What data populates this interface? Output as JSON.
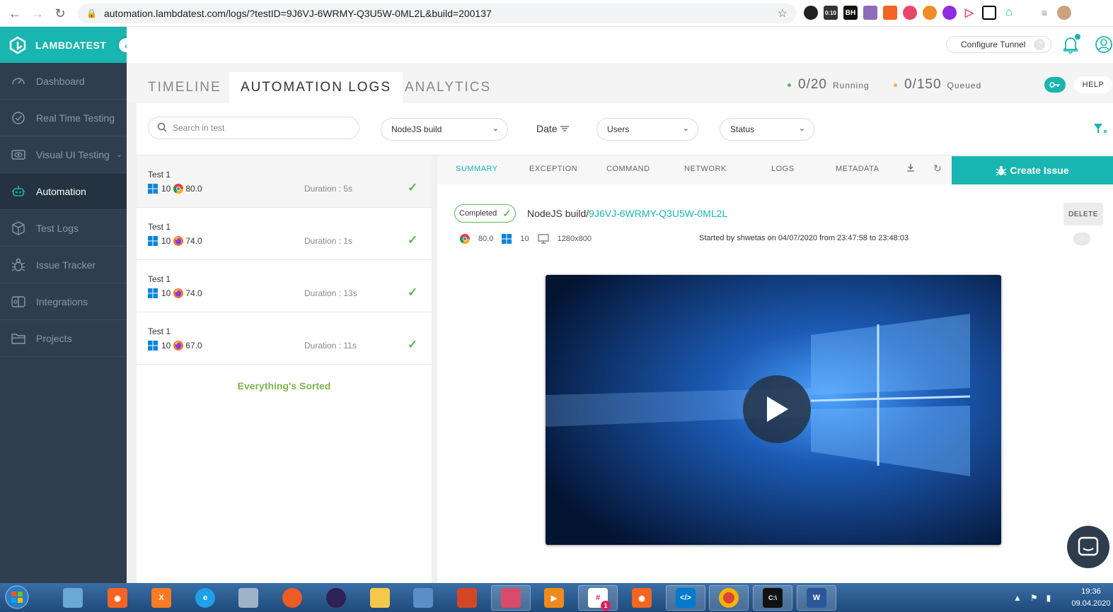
{
  "browser": {
    "url": "automation.lambdatest.com/logs/?testID=9J6VJ-6WRMY-Q3U5W-0ML2L&build=200137",
    "timer_badge": "0:10",
    "ext_bh": "BH"
  },
  "brand": {
    "name": "LAMBDATEST",
    "color": "#19b5b0"
  },
  "sidebar": {
    "items": [
      {
        "label": "Dashboard",
        "icon": "speedometer-icon"
      },
      {
        "label": "Real Time Testing",
        "icon": "clock-icon"
      },
      {
        "label": "Visual UI Testing",
        "icon": "eye-icon"
      },
      {
        "label": "Automation",
        "icon": "robot-icon",
        "active": true
      },
      {
        "label": "Test Logs",
        "icon": "cube-icon"
      },
      {
        "label": "Issue Tracker",
        "icon": "bug-icon"
      },
      {
        "label": "Integrations",
        "icon": "integrations-icon"
      },
      {
        "label": "Projects",
        "icon": "folder-icon"
      }
    ]
  },
  "topbar": {
    "tunnel_label": "Configure Tunnel",
    "tunnel_help": "?"
  },
  "tabs": {
    "timeline": "TIMELINE",
    "automation_logs": "AUTOMATION LOGS",
    "analytics": "ANALYTICS"
  },
  "stats": {
    "running_value": "0/20",
    "running_label": "Running",
    "running_color": "#5cb85c",
    "queued_value": "0/150",
    "queued_label": "Queued",
    "queued_color": "#f0ad4e"
  },
  "help_label": "HELP",
  "filters": {
    "search_placeholder": "Search in test",
    "build_select": "NodeJS build",
    "date_label": "Date",
    "users_select": "Users",
    "status_select": "Status"
  },
  "tests": [
    {
      "name": "Test 1",
      "os_version": "10",
      "browser": "chrome",
      "browser_version": "80.0",
      "duration": "Duration : 5s"
    },
    {
      "name": "Test 1",
      "os_version": "10",
      "browser": "firefox",
      "browser_version": "74.0",
      "duration": "Duration : 1s"
    },
    {
      "name": "Test 1",
      "os_version": "10",
      "browser": "firefox",
      "browser_version": "74.0",
      "duration": "Duration : 13s"
    },
    {
      "name": "Test 1",
      "os_version": "10",
      "browser": "firefox",
      "browser_version": "67.0",
      "duration": "Duration : 11s"
    }
  ],
  "sorted_message": "Everything's Sorted",
  "detail": {
    "tabs": [
      "SUMMARY",
      "EXCEPTION",
      "COMMAND",
      "NETWORK",
      "LOGS",
      "METADATA"
    ],
    "create_issue": "Create Issue",
    "status": "Completed",
    "build_prefix": "NodeJS build/",
    "test_id": "9J6VJ-6WRMY-Q3U5W-0ML2L",
    "delete_label": "DELETE",
    "browser_version": "80.0",
    "os_version": "10",
    "resolution": "1280x800",
    "started_text": "Started by shwetas on 04/07/2020 from 23:47:58 to 23:48:03"
  },
  "taskbar": {
    "time": "19:36",
    "date": "09.04.2020",
    "slack_badge": "1"
  }
}
